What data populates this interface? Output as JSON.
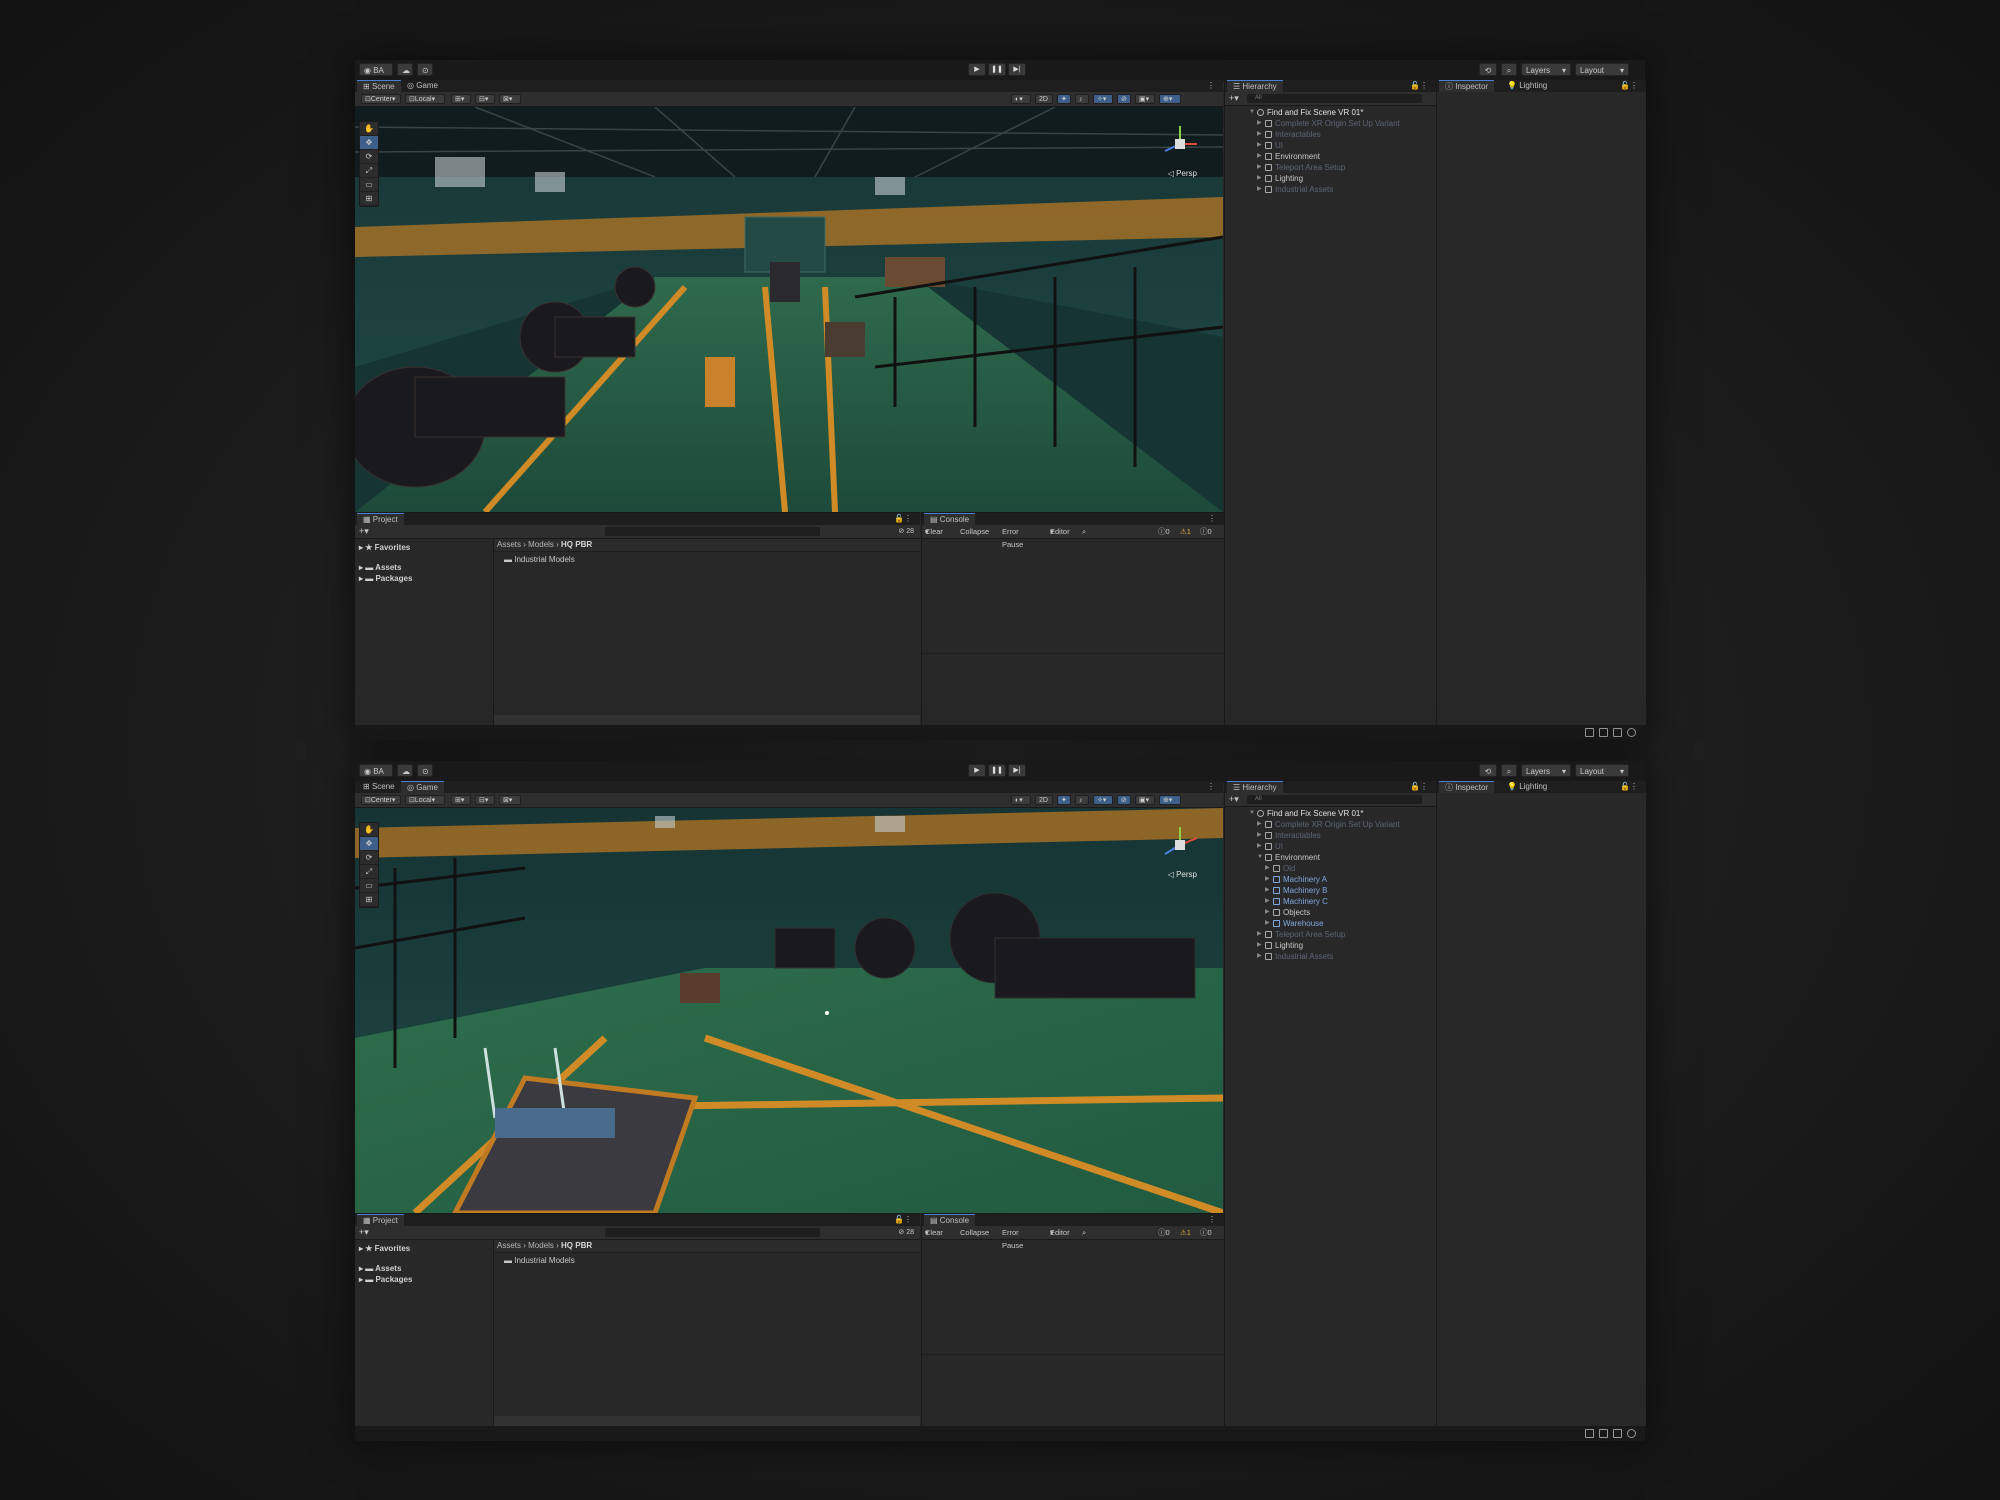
{
  "toolbar": {
    "account": "BA",
    "layers": "Layers",
    "layout": "Layout"
  },
  "tabs": {
    "scene": "Scene",
    "game": "Game",
    "hierarchy": "Hierarchy",
    "inspector": "Inspector",
    "lighting": "Lighting",
    "project": "Project",
    "console": "Console"
  },
  "scene_tools": {
    "pivot": "Center",
    "space": "Local",
    "mode_2d": "2D",
    "persp": "Persp"
  },
  "hierarchy": {
    "search_placeholder": "All",
    "top_items": [
      "Find and Fix Scene VR 01*",
      "Complete XR Origin Set Up Variant",
      "Interactables",
      "UI",
      "Environment",
      "Teleport Area Setup",
      "Lighting",
      "Industrial Assets"
    ],
    "bottom_items": [
      "Find and Fix Scene VR 01*",
      "Complete XR Origin Set Up Variant",
      "Interactables",
      "UI",
      "Environment",
      "Old",
      "Machinery A",
      "Machinery B",
      "Machinery C",
      "Objects",
      "Warehouse",
      "Teleport Area Setup",
      "Lighting",
      "Industrial Assets"
    ]
  },
  "project": {
    "favorites": "Favorites",
    "assets": "Assets",
    "packages": "Packages",
    "crumb_assets": "Assets",
    "crumb_models": "Models",
    "crumb_current": "HQ PBR",
    "folder": "Industrial Models",
    "hidden_count": "28"
  },
  "console": {
    "clear": "Clear",
    "collapse": "Collapse",
    "error_pause": "Error Pause",
    "editor": "Editor",
    "log_count": "0",
    "warn_count": "1",
    "error_count": "0"
  }
}
